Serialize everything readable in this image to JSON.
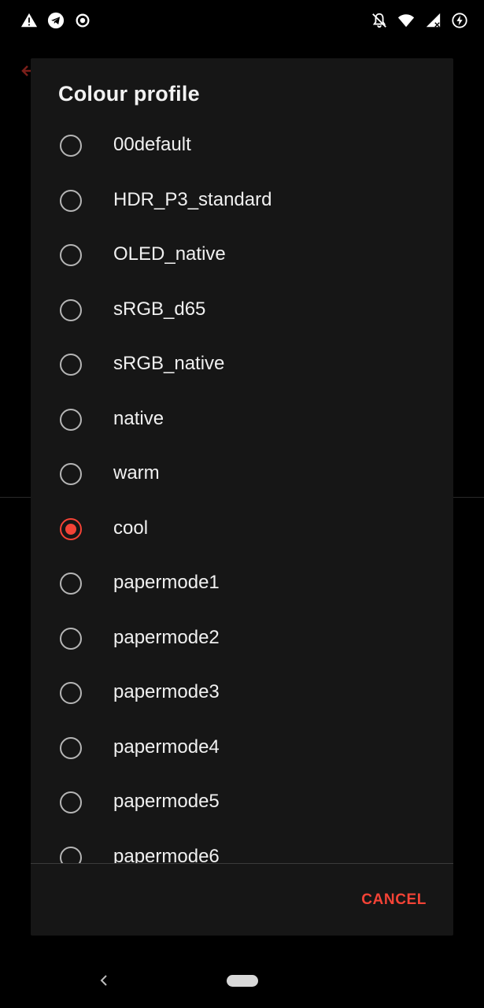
{
  "status_bar": {
    "left_icons": [
      "alert-icon",
      "telegram-icon",
      "target-icon"
    ],
    "right_icons": [
      "bell-off-icon",
      "wifi-icon",
      "signal-icon",
      "battery-charging-icon"
    ]
  },
  "dialog": {
    "title": "Colour profile",
    "options": [
      {
        "label": "00default",
        "selected": false
      },
      {
        "label": "HDR_P3_standard",
        "selected": false
      },
      {
        "label": "OLED_native",
        "selected": false
      },
      {
        "label": "sRGB_d65",
        "selected": false
      },
      {
        "label": "sRGB_native",
        "selected": false
      },
      {
        "label": "native",
        "selected": false
      },
      {
        "label": "warm",
        "selected": false
      },
      {
        "label": "cool",
        "selected": true
      },
      {
        "label": "papermode1",
        "selected": false
      },
      {
        "label": "papermode2",
        "selected": false
      },
      {
        "label": "papermode3",
        "selected": false
      },
      {
        "label": "papermode4",
        "selected": false
      },
      {
        "label": "papermode5",
        "selected": false
      },
      {
        "label": "papermode6",
        "selected": false
      }
    ],
    "cancel_label": "CANCEL"
  },
  "colors": {
    "accent": "#f44336",
    "dialog_bg": "#161616",
    "screen_bg": "#000000"
  }
}
